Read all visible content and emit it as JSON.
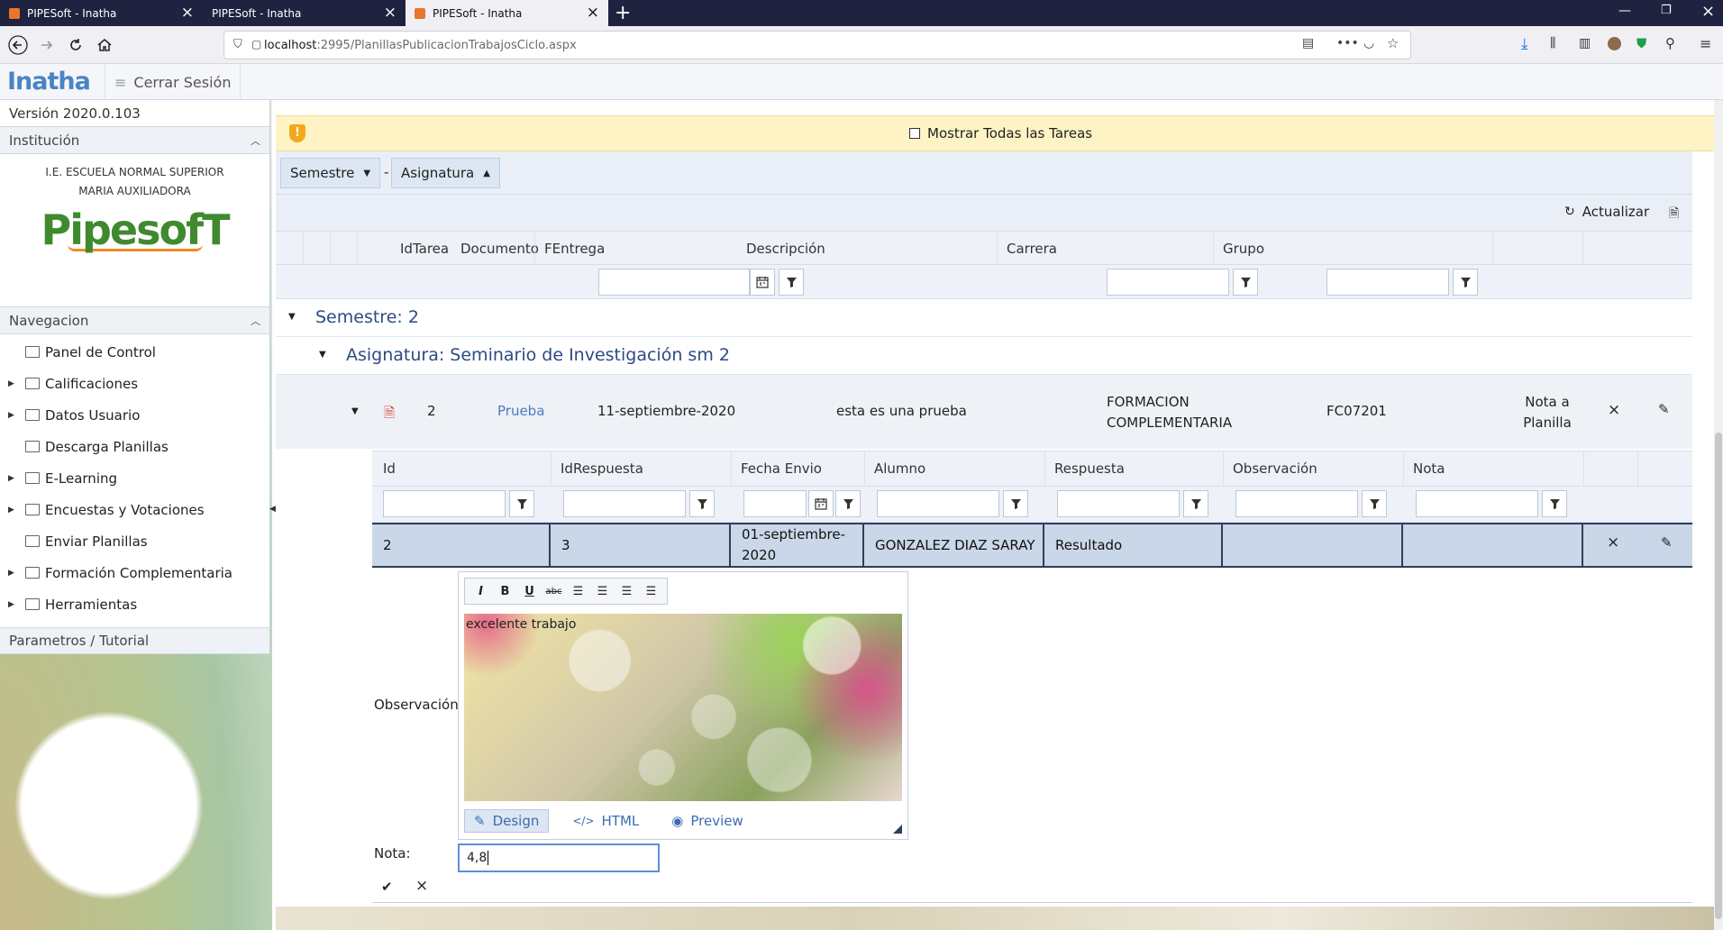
{
  "browser": {
    "tabs": [
      {
        "title": "PIPESoft - Inatha",
        "active": false
      },
      {
        "title": "PIPESoft - Inatha",
        "active": false
      },
      {
        "title": "PIPESoft - Inatha",
        "active": true
      }
    ],
    "url_host": "localhost",
    "url_path": ":2995/PlanillasPublicacionTrabajosCiclo.aspx"
  },
  "header": {
    "logo": "Inatha",
    "logout_label": "Cerrar Sesión"
  },
  "sidebar": {
    "version": "Versión 2020.0.103",
    "institution_header": "Institución",
    "institution_name": "I.E. ESCUELA NORMAL SUPERIOR MARIA AUXILIADORA",
    "pipesoft_logo": "PipesofT",
    "nav_header": "Navegacion",
    "items": [
      {
        "label": "Panel de Control",
        "expandable": false
      },
      {
        "label": "Calificaciones",
        "expandable": true
      },
      {
        "label": "Datos Usuario",
        "expandable": true
      },
      {
        "label": "Descarga Planillas",
        "expandable": false
      },
      {
        "label": "E-Learning",
        "expandable": true
      },
      {
        "label": "Encuestas y Votaciones",
        "expandable": true
      },
      {
        "label": "Enviar Planillas",
        "expandable": false
      },
      {
        "label": "Formación Complementaria",
        "expandable": true
      },
      {
        "label": "Herramientas",
        "expandable": true
      }
    ],
    "params_label": "Parametros / Tutorial"
  },
  "main": {
    "show_all_label": "Mostrar Todas las Tareas",
    "group_buttons": [
      {
        "label": "Semestre",
        "arrow": "▼"
      },
      {
        "label": "Asignatura",
        "arrow": "▲"
      }
    ],
    "group_separator": "-",
    "refresh_label": "Actualizar",
    "columns": [
      "IdTarea",
      "Documento",
      "FEntrega",
      "Descripción",
      "Carrera",
      "Grupo"
    ],
    "group_semester": "Semestre: 2",
    "group_subject": "Asignatura: Seminario de Investigación sm 2",
    "row": {
      "id": "2",
      "document": "Prueba",
      "date": "11-septiembre-2020",
      "description": "esta es una prueba",
      "carrera": "FORMACION COMPLEMENTARIA",
      "grupo": "FC07201",
      "nota_link": "Nota a Planilla"
    },
    "detail": {
      "columns": [
        "Id",
        "IdRespuesta",
        "Fecha Envio",
        "Alumno",
        "Respuesta",
        "Observación",
        "Nota"
      ],
      "row": {
        "id": "2",
        "id_respuesta": "3",
        "fecha": "01-septiembre-2020",
        "alumno": "GONZALEZ DIAZ SARAY",
        "respuesta": "Resultado",
        "observacion": "",
        "nota": ""
      }
    },
    "form": {
      "observacion_label": "Observación:",
      "editor_text": "excelente trabajo",
      "editor_tools": [
        "I",
        "B",
        "U",
        "abc"
      ],
      "editor_modes": [
        "Design",
        "HTML",
        "Preview"
      ],
      "nota_label": "Nota:",
      "nota_value": "4,8"
    }
  }
}
